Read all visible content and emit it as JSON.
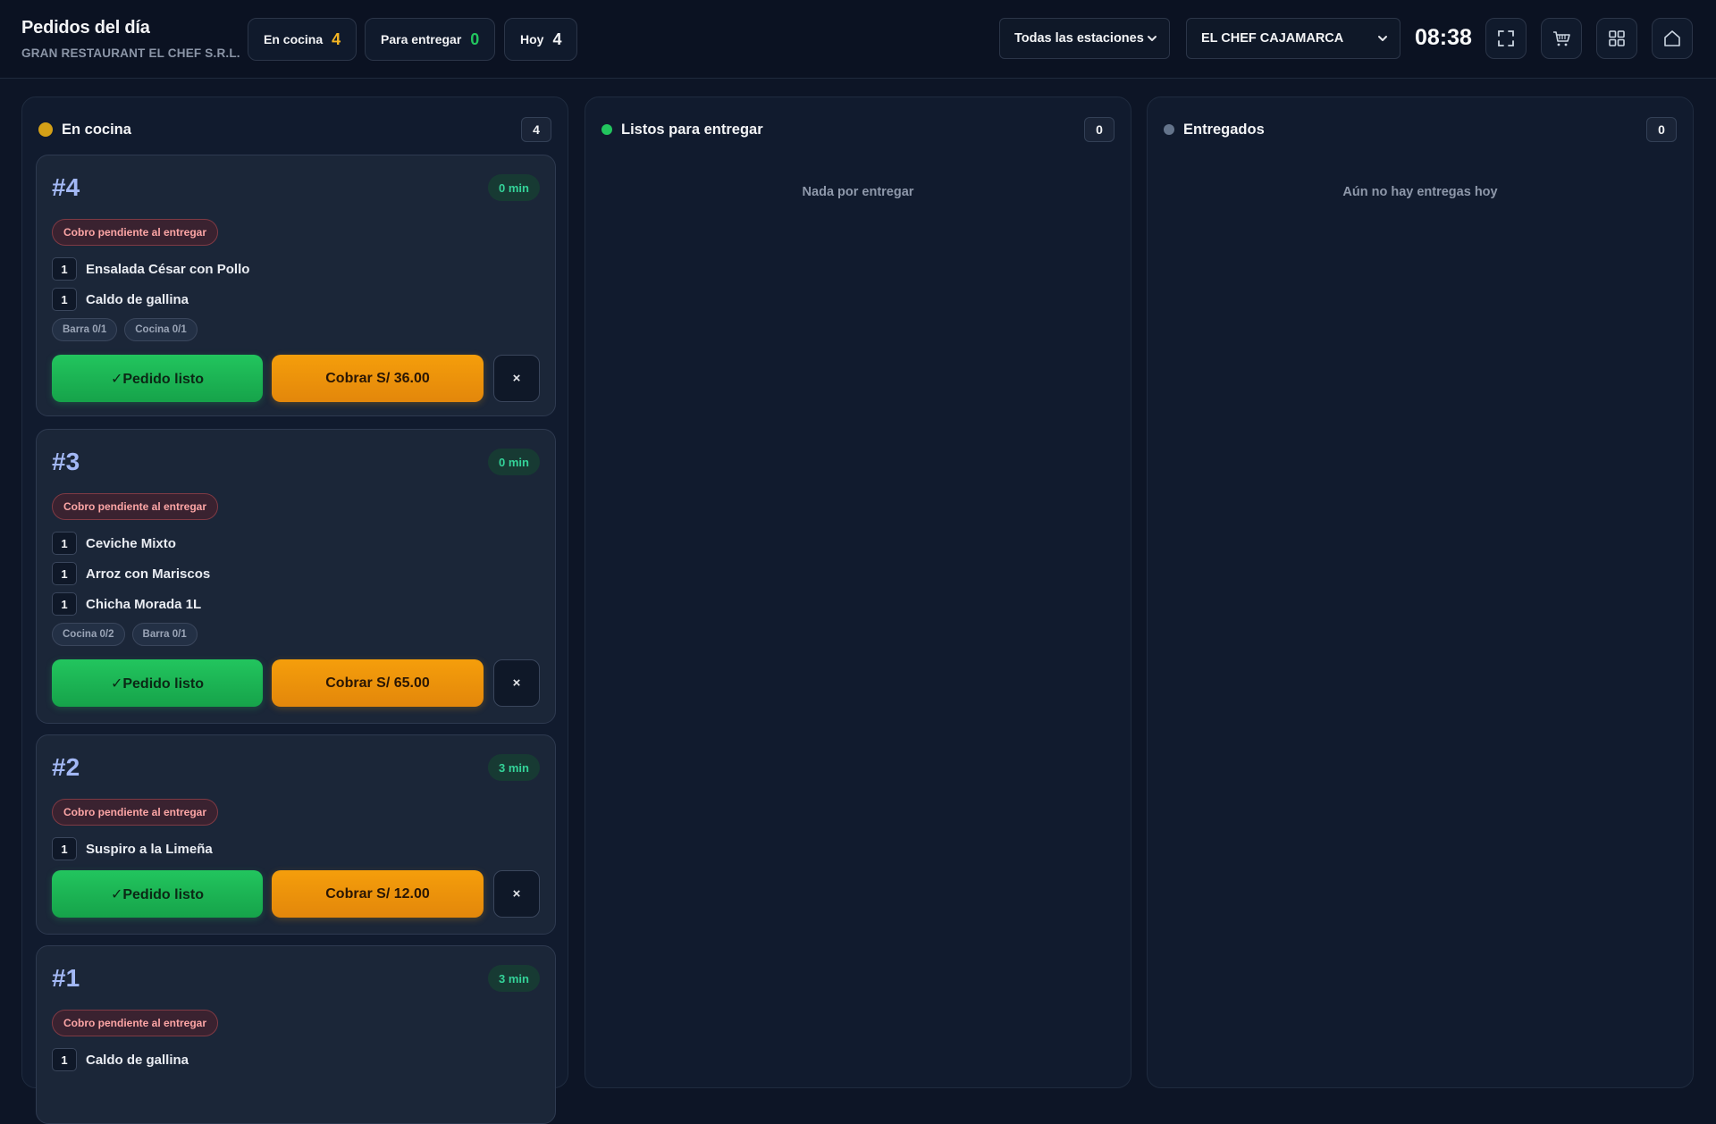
{
  "header": {
    "title": "Pedidos del día",
    "company": "GRAN RESTAURANT EL CHEF S.R.L.",
    "stats": [
      {
        "label": "En cocina",
        "value": "4"
      },
      {
        "label": "Para entregar",
        "value": "0"
      },
      {
        "label": "Hoy",
        "value": "4"
      }
    ],
    "station_select": "Todas las estaciones",
    "location_select": "EL CHEF CAJAMARCA",
    "clock": "08:38"
  },
  "colors": {
    "in_kitchen": "#d4a017",
    "ready": "#22c55e",
    "delivered": "#64748b",
    "accent_number": "#a3b8f5"
  },
  "columns": [
    {
      "title": "En cocina",
      "count": "4"
    },
    {
      "title": "Listos para entregar",
      "count": "0",
      "empty_text": "Nada por entregar"
    },
    {
      "title": "Entregados",
      "count": "0",
      "empty_text": "Aún no hay entregas hoy"
    }
  ],
  "orders": [
    {
      "number": "#4",
      "elapsed": "0 min",
      "payment_status": "Cobro pendiente al entregar",
      "items": [
        {
          "qty": "1",
          "name": "Ensalada César con Pollo"
        },
        {
          "qty": "1",
          "name": "Caldo de gallina"
        }
      ],
      "stations": [
        "Barra 0/1",
        "Cocina 0/1"
      ],
      "ready_label": "✓Pedido listo",
      "pay_label": "Cobrar S/ 36.00",
      "cancel_label": "×"
    },
    {
      "number": "#3",
      "elapsed": "0 min",
      "payment_status": "Cobro pendiente al entregar",
      "items": [
        {
          "qty": "1",
          "name": "Ceviche Mixto"
        },
        {
          "qty": "1",
          "name": "Arroz con Mariscos"
        },
        {
          "qty": "1",
          "name": "Chicha Morada 1L"
        }
      ],
      "stations": [
        "Cocina 0/2",
        "Barra 0/1"
      ],
      "ready_label": "✓Pedido listo",
      "pay_label": "Cobrar S/ 65.00",
      "cancel_label": "×"
    },
    {
      "number": "#2",
      "elapsed": "3 min",
      "payment_status": "Cobro pendiente al entregar",
      "items": [
        {
          "qty": "1",
          "name": "Suspiro a la Limeña"
        }
      ],
      "ready_label": "✓Pedido listo",
      "pay_label": "Cobrar S/ 12.00",
      "cancel_label": "×"
    },
    {
      "number": "#1",
      "elapsed": "3 min",
      "payment_status": "Cobro pendiente al entregar",
      "items": [
        {
          "qty": "1",
          "name": "Caldo de gallina"
        }
      ]
    }
  ]
}
